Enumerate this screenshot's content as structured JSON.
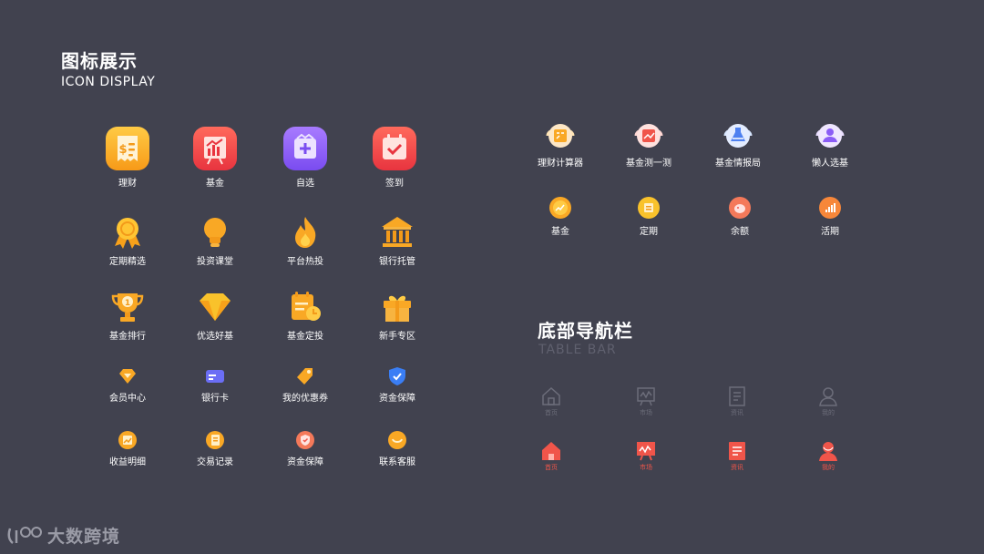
{
  "header": {
    "title_cn": "图标展示",
    "title_en": "ICON DISPLAY"
  },
  "big_icons": [
    {
      "label": "理财",
      "icon": "receipt-money-icon"
    },
    {
      "label": "基金",
      "icon": "chart-board-icon"
    },
    {
      "label": "自选",
      "icon": "bag-plus-icon"
    },
    {
      "label": "签到",
      "icon": "calendar-check-icon"
    }
  ],
  "row2": [
    {
      "label": "定期精选",
      "icon": "award-ribbon-icon"
    },
    {
      "label": "投资课堂",
      "icon": "lightbulb-icon"
    },
    {
      "label": "平台热投",
      "icon": "flame-icon"
    },
    {
      "label": "银行托管",
      "icon": "bank-building-icon"
    }
  ],
  "row3": [
    {
      "label": "基金排行",
      "icon": "trophy-icon"
    },
    {
      "label": "优选好基",
      "icon": "diamond-icon"
    },
    {
      "label": "基金定投",
      "icon": "scheduled-doc-icon"
    },
    {
      "label": "新手专区",
      "icon": "gift-icon"
    }
  ],
  "row4": [
    {
      "label": "会员中心",
      "icon": "small-diamond-icon"
    },
    {
      "label": "银行卡",
      "icon": "bank-card-icon"
    },
    {
      "label": "我的优惠券",
      "icon": "coupon-tag-icon"
    },
    {
      "label": "资金保障",
      "icon": "shield-check-icon"
    }
  ],
  "row5": [
    {
      "label": "收益明细",
      "icon": "earnings-icon"
    },
    {
      "label": "交易记录",
      "icon": "transaction-record-icon"
    },
    {
      "label": "资金保障",
      "icon": "shield-badge-icon"
    },
    {
      "label": "联系客服",
      "icon": "customer-service-icon"
    }
  ],
  "right_icons": [
    {
      "label": "理财计算器",
      "icon": "calculator-icon"
    },
    {
      "label": "基金测一测",
      "icon": "fund-test-icon"
    },
    {
      "label": "基金情报局",
      "icon": "flask-icon"
    },
    {
      "label": "懒人选基",
      "icon": "person-pick-icon"
    }
  ],
  "right_small": [
    {
      "label": "基金",
      "icon": "fund-coin-icon"
    },
    {
      "label": "定期",
      "icon": "fixed-term-coin-icon"
    },
    {
      "label": "余额",
      "icon": "piggy-coin-icon"
    },
    {
      "label": "活期",
      "icon": "current-coin-icon"
    }
  ],
  "tabbar_section": {
    "title_cn": "底部导航栏",
    "title_en": "TABLE BAR"
  },
  "tabbar_inactive": [
    {
      "label": "首页",
      "icon": "home-outline-icon"
    },
    {
      "label": "市场",
      "icon": "market-outline-icon"
    },
    {
      "label": "资讯",
      "icon": "news-outline-icon"
    },
    {
      "label": "我的",
      "icon": "profile-outline-icon"
    }
  ],
  "tabbar_active": [
    {
      "label": "首页",
      "icon": "home-filled-icon"
    },
    {
      "label": "市场",
      "icon": "market-filled-icon"
    },
    {
      "label": "资讯",
      "icon": "news-filled-icon"
    },
    {
      "label": "我的",
      "icon": "profile-filled-icon"
    }
  ],
  "watermark": {
    "text": "大数跨境"
  },
  "colors": {
    "background": "#41424f",
    "orange": "#f9a825",
    "red": "#f0554a",
    "purple": "#8b5cf6",
    "inactive_gray": "#6c6d7a"
  }
}
